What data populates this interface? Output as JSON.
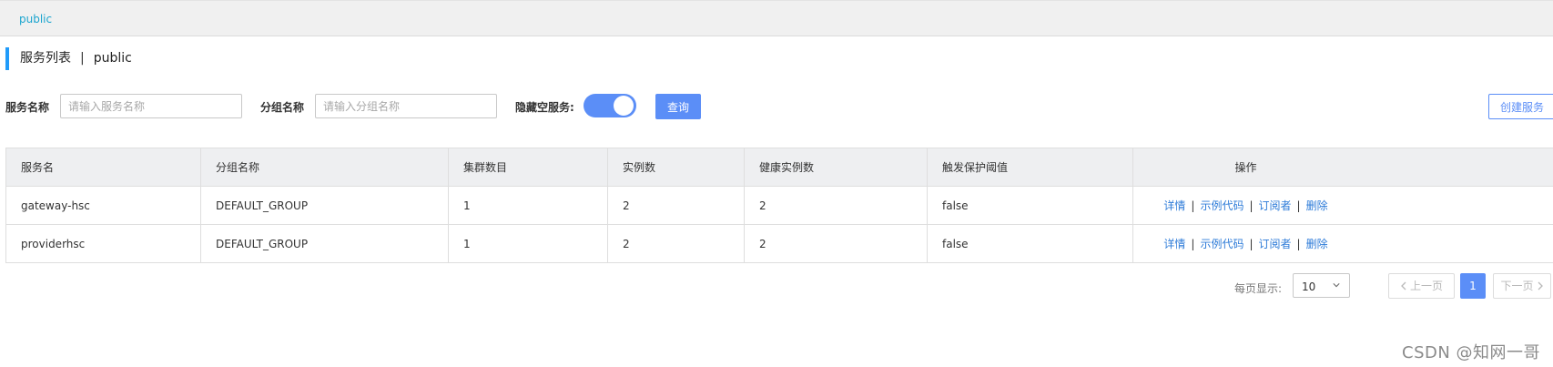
{
  "namespace_bar": {
    "active_namespace": "public"
  },
  "page_title": {
    "label": "服务列表",
    "separator": "|",
    "namespace": "public"
  },
  "filters": {
    "service_name_label": "服务名称",
    "service_name_placeholder": "请输入服务名称",
    "service_name_value": "",
    "group_name_label": "分组名称",
    "group_name_placeholder": "请输入分组名称",
    "group_name_value": "",
    "hide_empty_label": "隐藏空服务:",
    "hide_empty_on": true,
    "query_button": "查询",
    "create_button": "创建服务"
  },
  "table": {
    "columns": [
      "服务名",
      "分组名称",
      "集群数目",
      "实例数",
      "健康实例数",
      "触发保护阈值",
      "操作"
    ],
    "rows": [
      {
        "service": "gateway-hsc",
        "group": "DEFAULT_GROUP",
        "clusters": "1",
        "instances": "2",
        "healthy": "2",
        "protect": "false"
      },
      {
        "service": "providerhsc",
        "group": "DEFAULT_GROUP",
        "clusters": "1",
        "instances": "2",
        "healthy": "2",
        "protect": "false"
      }
    ],
    "actions": {
      "detail": "详情",
      "sample_code": "示例代码",
      "subscribers": "订阅者",
      "delete": "删除",
      "sep": "|"
    }
  },
  "pagination": {
    "page_size_label": "每页显示:",
    "page_size": "10",
    "prev": "上一页",
    "current_page": "1",
    "next": "下一页"
  },
  "watermark": "CSDN @知网一哥",
  "colors": {
    "primary": "#5b8ef7",
    "link": "#2d7bd8",
    "namespace": "#1ba5cf",
    "header_bg": "#eeeff1"
  },
  "icons": {
    "page_size": "chevron-down-icon",
    "prev": "chevron-left-icon",
    "next": "chevron-right-icon"
  }
}
